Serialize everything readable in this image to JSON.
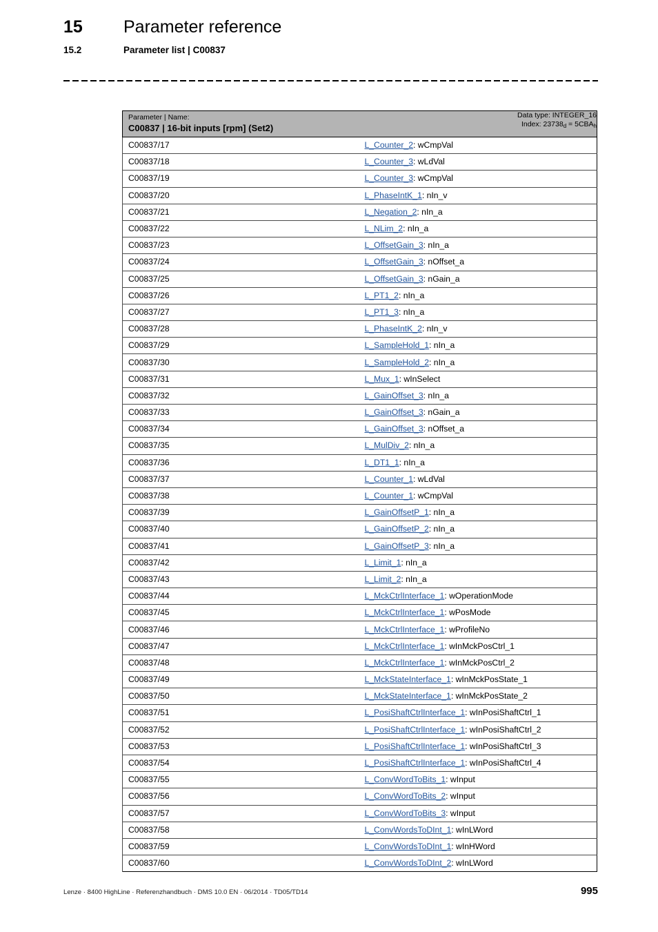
{
  "header": {
    "chapter_number": "15",
    "chapter_title": "Parameter reference",
    "section_number": "15.2",
    "section_title": "Parameter list | C00837"
  },
  "table": {
    "col_header_left_small": "Parameter | Name:",
    "col_header_left_big": "C00837 | 16-bit inputs [rpm] (Set2)",
    "data_type_line": "Data type: INTEGER_16",
    "index_label": "Index: ",
    "index_dec": "23738",
    "index_dec_sub": "d",
    "index_eq": " = ",
    "index_hex": "5CBA",
    "index_hex_sub": "h",
    "header_bg": "#b4b4b4",
    "link_color": "#23559c",
    "rows": [
      {
        "param": "C00837/17",
        "link": "L_Counter_2",
        "suffix": ": wCmpVal"
      },
      {
        "param": "C00837/18",
        "link": "L_Counter_3",
        "suffix": ": wLdVal"
      },
      {
        "param": "C00837/19",
        "link": "L_Counter_3",
        "suffix": ": wCmpVal"
      },
      {
        "param": "C00837/20",
        "link": "L_PhaseIntK_1",
        "suffix": ": nIn_v"
      },
      {
        "param": "C00837/21",
        "link": "L_Negation_2",
        "suffix": ": nIn_a"
      },
      {
        "param": "C00837/22",
        "link": "L_NLim_2",
        "suffix": ": nIn_a"
      },
      {
        "param": "C00837/23",
        "link": "L_OffsetGain_3",
        "suffix": ": nIn_a"
      },
      {
        "param": "C00837/24",
        "link": "L_OffsetGain_3",
        "suffix": ": nOffset_a"
      },
      {
        "param": "C00837/25",
        "link": "L_OffsetGain_3",
        "suffix": ": nGain_a"
      },
      {
        "param": "C00837/26",
        "link": "L_PT1_2",
        "suffix": ": nIn_a"
      },
      {
        "param": "C00837/27",
        "link": "L_PT1_3",
        "suffix": ": nIn_a"
      },
      {
        "param": "C00837/28",
        "link": "L_PhaseIntK_2",
        "suffix": ": nIn_v"
      },
      {
        "param": "C00837/29",
        "link": "L_SampleHold_1",
        "suffix": ": nIn_a"
      },
      {
        "param": "C00837/30",
        "link": "L_SampleHold_2",
        "suffix": ": nIn_a"
      },
      {
        "param": "C00837/31",
        "link": "L_Mux_1",
        "suffix": ": wInSelect"
      },
      {
        "param": "C00837/32",
        "link": "L_GainOffset_3",
        "suffix": ": nIn_a"
      },
      {
        "param": "C00837/33",
        "link": "L_GainOffset_3",
        "suffix": ": nGain_a"
      },
      {
        "param": "C00837/34",
        "link": "L_GainOffset_3",
        "suffix": ": nOffset_a"
      },
      {
        "param": "C00837/35",
        "link": "L_MulDiv_2",
        "suffix": ": nIn_a"
      },
      {
        "param": "C00837/36",
        "link": "L_DT1_1",
        "suffix": ": nIn_a"
      },
      {
        "param": "C00837/37",
        "link": "L_Counter_1",
        "suffix": ": wLdVal"
      },
      {
        "param": "C00837/38",
        "link": "L_Counter_1",
        "suffix": ": wCmpVal"
      },
      {
        "param": "C00837/39",
        "link": "L_GainOffsetP_1",
        "suffix": ": nIn_a"
      },
      {
        "param": "C00837/40",
        "link": "L_GainOffsetP_2",
        "suffix": ": nIn_a"
      },
      {
        "param": "C00837/41",
        "link": "L_GainOffsetP_3",
        "suffix": ": nIn_a"
      },
      {
        "param": "C00837/42",
        "link": "L_Limit_1",
        "suffix": ": nIn_a"
      },
      {
        "param": "C00837/43",
        "link": "L_Limit_2",
        "suffix": ": nIn_a"
      },
      {
        "param": "C00837/44",
        "link": "L_MckCtrlInterface_1",
        "suffix": ": wOperationMode"
      },
      {
        "param": "C00837/45",
        "link": "L_MckCtrlInterface_1",
        "suffix": ": wPosMode"
      },
      {
        "param": "C00837/46",
        "link": "L_MckCtrlInterface_1",
        "suffix": ": wProfileNo"
      },
      {
        "param": "C00837/47",
        "link": "L_MckCtrlInterface_1",
        "suffix": ": wInMckPosCtrl_1"
      },
      {
        "param": "C00837/48",
        "link": "L_MckCtrlInterface_1",
        "suffix": ": wInMckPosCtrl_2"
      },
      {
        "param": "C00837/49",
        "link": "L_MckStateInterface_1",
        "suffix": ": wInMckPosState_1"
      },
      {
        "param": "C00837/50",
        "link": "L_MckStateInterface_1",
        "suffix": ": wInMckPosState_2"
      },
      {
        "param": "C00837/51",
        "link": "L_PosiShaftCtrlInterface_1",
        "suffix": ": wInPosiShaftCtrl_1"
      },
      {
        "param": "C00837/52",
        "link": "L_PosiShaftCtrlInterface_1",
        "suffix": ": wInPosiShaftCtrl_2"
      },
      {
        "param": "C00837/53",
        "link": "L_PosiShaftCtrlInterface_1",
        "suffix": ": wInPosiShaftCtrl_3"
      },
      {
        "param": "C00837/54",
        "link": "L_PosiShaftCtrlInterface_1",
        "suffix": ": wInPosiShaftCtrl_4"
      },
      {
        "param": "C00837/55",
        "link": "L_ConvWordToBits_1",
        "suffix": ": wInput"
      },
      {
        "param": "C00837/56",
        "link": "L_ConvWordToBits_2",
        "suffix": ": wInput"
      },
      {
        "param": "C00837/57",
        "link": "L_ConvWordToBits_3",
        "suffix": ": wInput"
      },
      {
        "param": "C00837/58",
        "link": "L_ConvWordsToDInt_1",
        "suffix": ": wInLWord"
      },
      {
        "param": "C00837/59",
        "link": "L_ConvWordsToDInt_1",
        "suffix": ": wInHWord"
      },
      {
        "param": "C00837/60",
        "link": "L_ConvWordsToDInt_2",
        "suffix": ": wInLWord"
      }
    ]
  },
  "footer": {
    "imprint": "Lenze · 8400 HighLine · Referenzhandbuch · DMS 10.0 EN · 06/2014 · TD05/TD14",
    "page_number": "995"
  }
}
